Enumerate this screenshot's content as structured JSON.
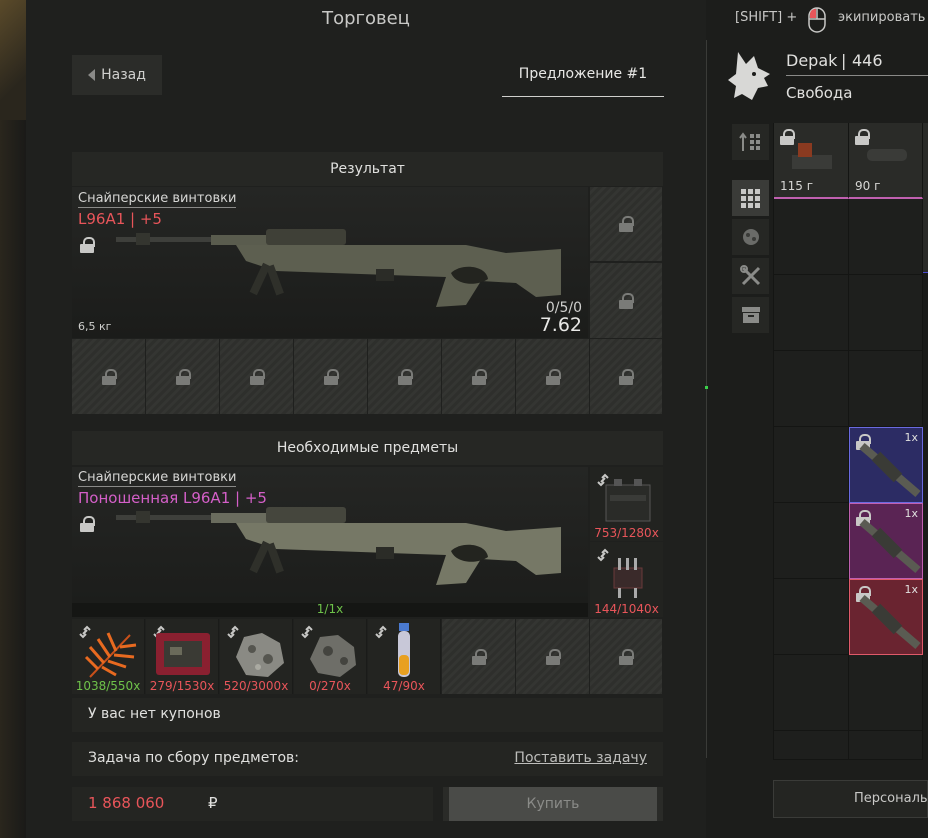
{
  "header": {
    "title": "Торговец",
    "equip_hint_key": "[SHIFT] +",
    "equip_hint_action": "экипировать"
  },
  "nav": {
    "back_label": "Назад",
    "offer_tab": "Предложение #1"
  },
  "result": {
    "heading": "Результат",
    "category": "Снайперские винтовки",
    "name": "L96A1 | +5",
    "name_color": "#e8555a",
    "weight": "6,5 кг",
    "ammo_count": "0/5/0",
    "caliber": "7.62"
  },
  "required": {
    "heading": "Необходимые предметы",
    "category": "Снайперские винтовки",
    "name": "Поношенная L96A1 | +5",
    "name_color": "#d45fc8",
    "weapon_qty": "1/1x",
    "side_items": [
      {
        "name": "battery-icon",
        "qty": "753/1280x",
        "qty_color": "#e8555a"
      },
      {
        "name": "electronic-component-icon",
        "qty": "144/1040x",
        "qty_color": "#e8555a"
      }
    ],
    "items": [
      {
        "name": "fern-plant-icon",
        "qty": "1038/550x",
        "qty_color": "#6ec24a"
      },
      {
        "name": "circuit-board-icon",
        "qty": "279/1530x",
        "qty_color": "#e8555a"
      },
      {
        "name": "ore-rock-icon",
        "qty": "520/3000x",
        "qty_color": "#e8555a"
      },
      {
        "name": "ore-rock-icon",
        "qty": "0/270x",
        "qty_color": "#e8555a"
      },
      {
        "name": "flask-icon",
        "qty": "47/90x",
        "qty_color": "#e8555a"
      }
    ]
  },
  "coupons": {
    "text": "У вас нет купонов"
  },
  "task": {
    "label": "Задача по сбору предметов:",
    "link": "Поставить задачу"
  },
  "price": {
    "value": "1 868 060",
    "currency": "₽",
    "buy_label": "Купить"
  },
  "player": {
    "name": "Depak",
    "level": "446",
    "faction": "Свобода"
  },
  "inventory": {
    "top_items": [
      {
        "weight": "115 г"
      },
      {
        "weight": "90 г"
      }
    ],
    "stack_items": [
      {
        "count": "1x",
        "color": "#3a3a8a"
      },
      {
        "count": "1x",
        "color": "#7a2a6a"
      },
      {
        "count": "1x",
        "color": "#8a2a3a"
      }
    ],
    "personal_label": "Персональн"
  },
  "colors": {
    "accent_red": "#e8555a",
    "accent_green": "#6ec24a",
    "accent_pink": "#d45fc8"
  }
}
